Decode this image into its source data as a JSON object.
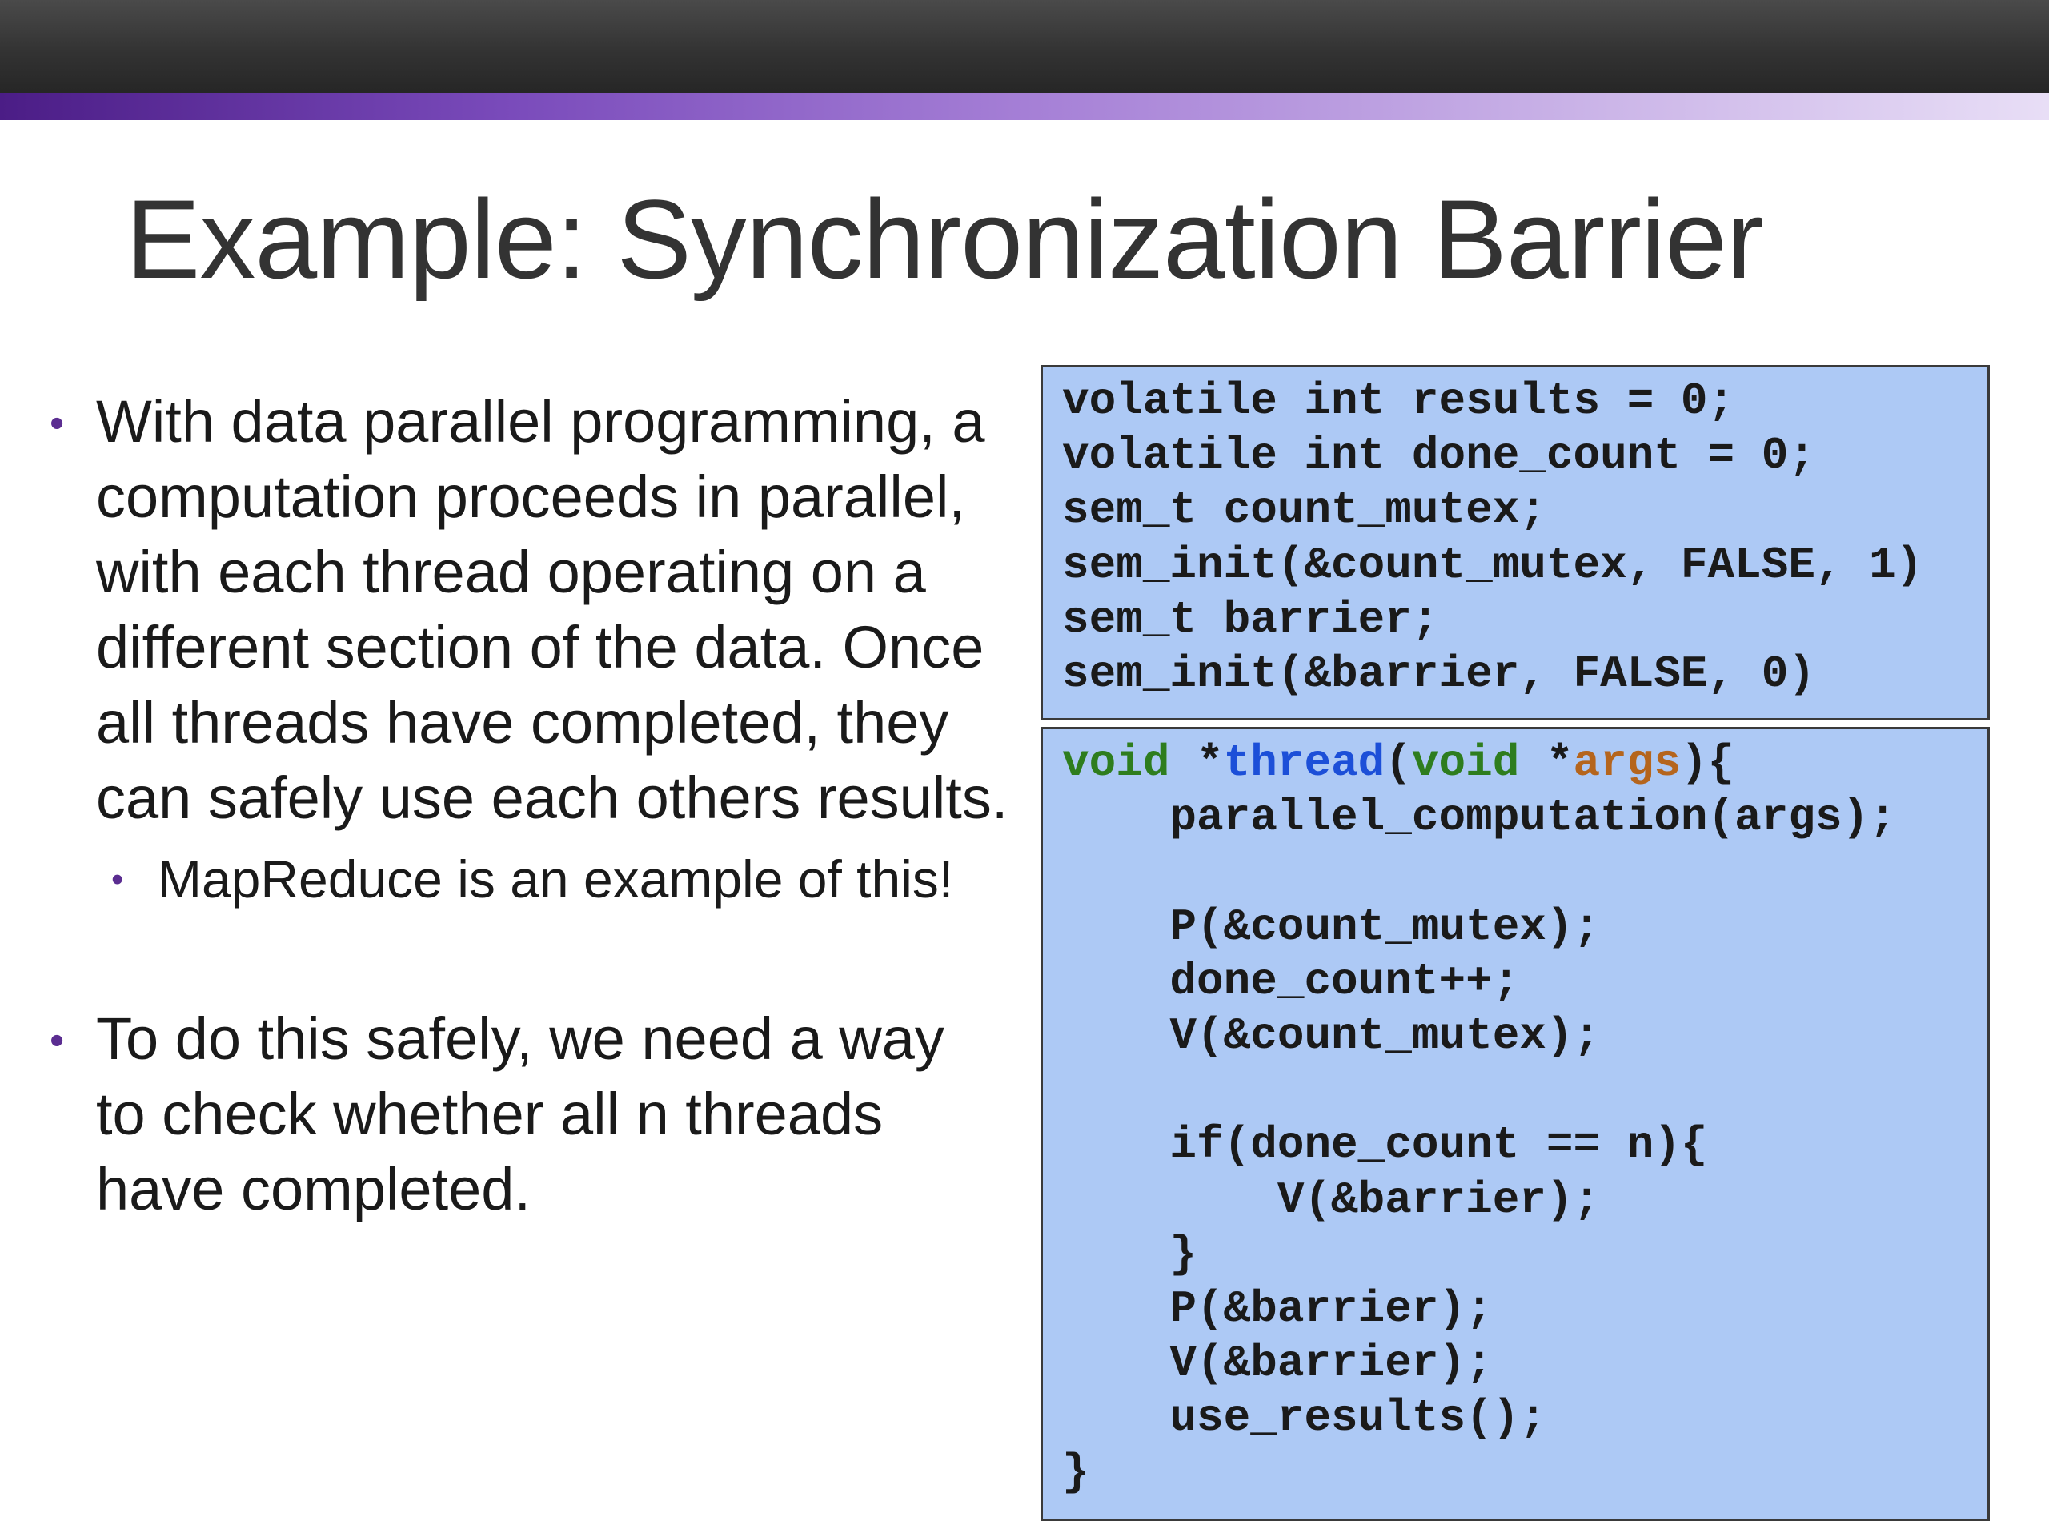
{
  "slide": {
    "title": "Example: Synchronization Barrier",
    "bullets": [
      {
        "level": 1,
        "text": "With data parallel programming, a computation proceeds in parallel, with each thread operating on a different section of the data. Once all threads have completed, they can safely use each others results."
      },
      {
        "level": 2,
        "text": "MapReduce is an example of this!"
      },
      {
        "level": 1,
        "text": "To do this safely, we need a way to check whether all n threads have completed."
      }
    ],
    "bullet_symbol": "•"
  },
  "code_box_1": {
    "lines": [
      "volatile int results = 0;",
      "volatile int done_count = 0;",
      "sem_t count_mutex;",
      "sem_init(&count_mutex, FALSE, 1)",
      "sem_t barrier;",
      "sem_init(&barrier, FALSE, 0)"
    ]
  },
  "code_box_2": {
    "signature": {
      "type": "void",
      "star": " *",
      "name": "thread",
      "open": "(",
      "param_type": "void",
      "param_star": " *",
      "param_name": "args",
      "close": "){"
    },
    "lines": [
      "    parallel_computation(args);",
      "",
      "    P(&count_mutex);",
      "    done_count++;",
      "    V(&count_mutex);",
      "",
      "    if(done_count == n){",
      "        V(&barrier);",
      "    }",
      "    P(&barrier);",
      "    V(&barrier);",
      "    use_results();",
      "}"
    ]
  },
  "colors": {
    "top_bar": "#333333",
    "accent_gradient_start": "#4b1d86",
    "accent_gradient_end": "#e8def6",
    "bullet_marker": "#5b2d91",
    "code_background": "#adc9f5",
    "keyword": "#2e7d1e",
    "function_name": "#1c4fd8",
    "argument_name": "#b5651d"
  }
}
